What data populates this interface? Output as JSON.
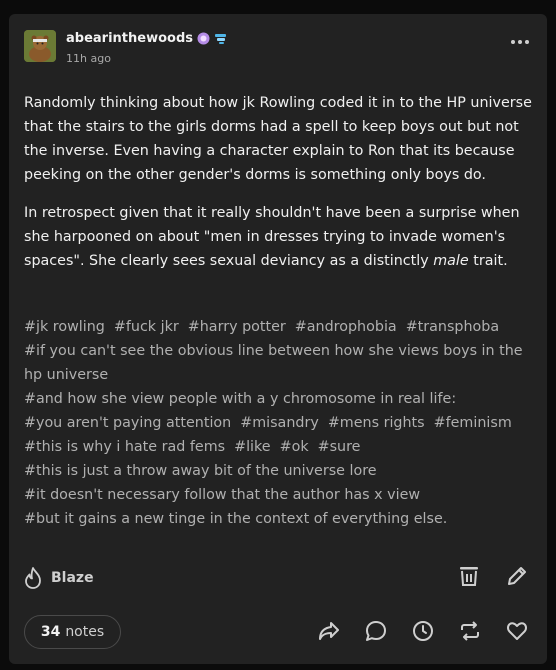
{
  "post": {
    "username": "abearinthewoods",
    "timestamp": "11h ago",
    "body": [
      "Randomly thinking about how jk Rowling coded it in to the HP universe that the stairs to the girls dorms had a spell to keep boys out but not the inverse. Even having a character explain to Ron that its because peeking on the other gender's dorms is something only boys do.",
      "In retrospect given that it really shouldn't have been a surprise when she harpooned on about \"men in dresses trying to invade women's spaces\". She clearly sees sexual deviancy as a distinctly ",
      "male",
      " trait."
    ],
    "tags": {
      "line1": [
        "#jk rowling",
        "#fuck jkr",
        "#harry potter",
        "#androphobia",
        "#transphoba"
      ],
      "line2": "#if you can't see the obvious line between how she views boys in the hp universe",
      "line3": "#and how she view people with a y chromosome in real life:",
      "line4": [
        "#you aren't paying attention",
        "#misandry",
        "#mens rights",
        "#feminism"
      ],
      "line5": [
        "#this is why i hate rad fems",
        "#like",
        "#ok",
        "#sure"
      ],
      "line6": "#this is just a throw away bit of the universe lore",
      "line7": "#it doesn't necessary follow that the author has x view",
      "line8": "#but it gains a new tinge in the context of everything else."
    },
    "blaze_label": "Blaze",
    "notes_count": "34",
    "notes_label": "notes"
  },
  "icons": {
    "avatar": "bear-avatar",
    "badges": [
      "purple-badge-icon",
      "blue-badge-icon"
    ],
    "more": "more-options-icon",
    "blaze": "flame-icon",
    "tools": [
      "trash-icon",
      "edit-pencil-icon"
    ],
    "actions": [
      "share-icon",
      "reply-icon",
      "history-icon",
      "reblog-icon",
      "like-heart-icon"
    ]
  },
  "colors": {
    "card_bg": "#222222",
    "page_bg": "#0b0b0b",
    "tag_text": "#b0b0b0"
  }
}
